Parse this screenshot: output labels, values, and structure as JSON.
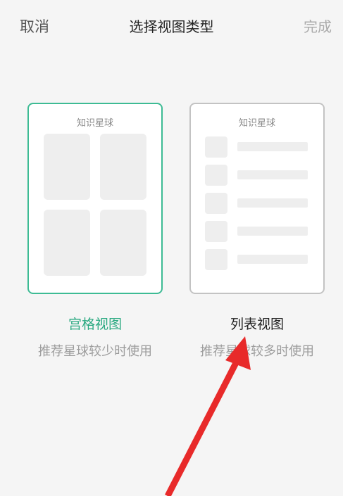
{
  "header": {
    "cancel_label": "取消",
    "title": "选择视图类型",
    "done_label": "完成"
  },
  "options": [
    {
      "card_title": "知识星球",
      "label": "宫格视图",
      "description": "推荐星球较少时使用",
      "selected": true
    },
    {
      "card_title": "知识星球",
      "label": "列表视图",
      "description": "推荐星球较多时使用",
      "selected": false
    }
  ],
  "colors": {
    "accent": "#3dbb94",
    "annotation_arrow": "#e82a2a"
  }
}
